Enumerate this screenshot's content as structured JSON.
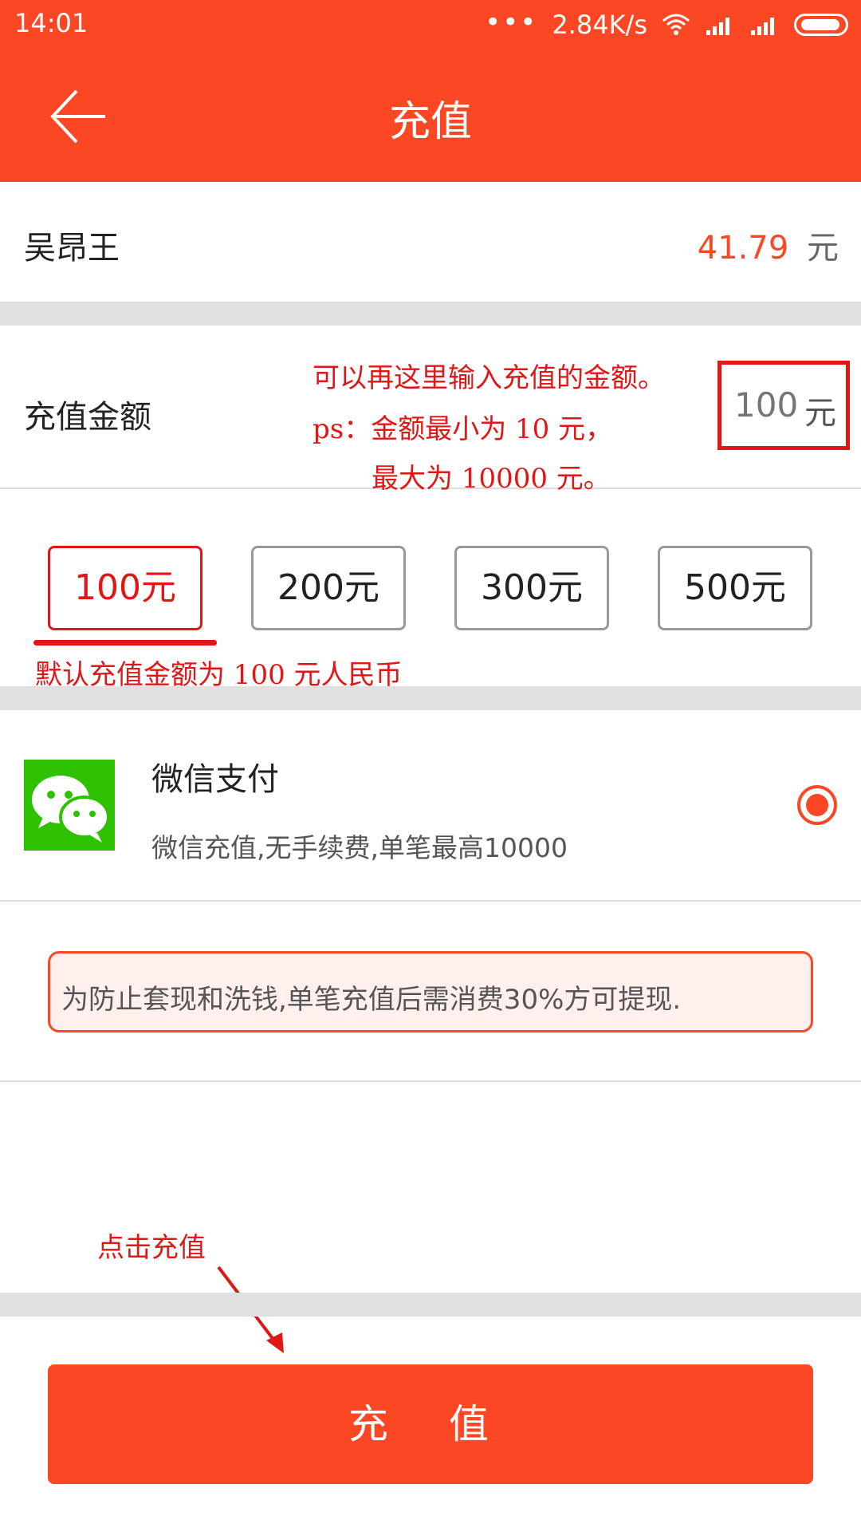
{
  "status_bar": {
    "time": "14:01",
    "network_speed": "2.84K/s"
  },
  "header": {
    "title": "充值"
  },
  "balance": {
    "name": "吴昂王",
    "amount": "41.79",
    "unit": "元"
  },
  "amount": {
    "label": "充值金额",
    "placeholder": "100",
    "unit": "元"
  },
  "annotations": {
    "line1": "可以再这里输入充值的金额。",
    "line2": "ps：金额最小为 10 元，",
    "line3": "最大为 10000 元。",
    "default_note": "默认充值金额为 100 元人民币",
    "click_note": "点击充值"
  },
  "quick_amounts": [
    {
      "label": "100元",
      "selected": true
    },
    {
      "label": "200元",
      "selected": false
    },
    {
      "label": "300元",
      "selected": false
    },
    {
      "label": "500元",
      "selected": false
    }
  ],
  "payment": {
    "title": "微信支付",
    "description": "微信充值,无手续费,单笔最高10000",
    "icon": "wechat-icon",
    "selected": true
  },
  "warning": {
    "text": "为防止套现和洗钱,单笔充值后需消费30%方可提现."
  },
  "submit": {
    "label": "充 值"
  },
  "colors": {
    "primary": "#fc4725",
    "annotation": "#e11616",
    "wechat": "#2ec100"
  }
}
